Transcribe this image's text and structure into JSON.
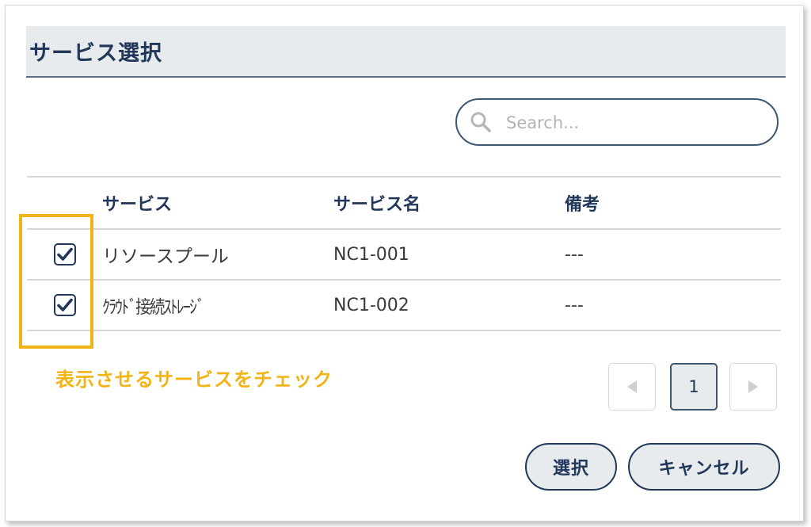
{
  "dialog": {
    "title": "サービス選択"
  },
  "search": {
    "placeholder": "Search...",
    "value": ""
  },
  "table": {
    "headers": {
      "service": "サービス",
      "service_name": "サービス名",
      "note": "備考"
    },
    "rows": [
      {
        "checked": true,
        "service": "リソースプール",
        "service_name": "NC1-001",
        "note": "---"
      },
      {
        "checked": true,
        "service": "ｸﾗｳﾄﾞ接続ｽﾄﾚｰｼﾞ",
        "service_name": "NC1-002",
        "note": "---"
      }
    ]
  },
  "annotation": {
    "text": "表示させるサービスをチェック",
    "color": "#f2b315"
  },
  "pagination": {
    "current_page": "1",
    "prev_icon": "triangle-left-icon",
    "next_icon": "triangle-right-icon"
  },
  "actions": {
    "select_label": "選択",
    "cancel_label": "キャンセル"
  },
  "colors": {
    "primary": "#22375a",
    "header_bg": "#e7ebed",
    "highlight": "#f2b315"
  }
}
